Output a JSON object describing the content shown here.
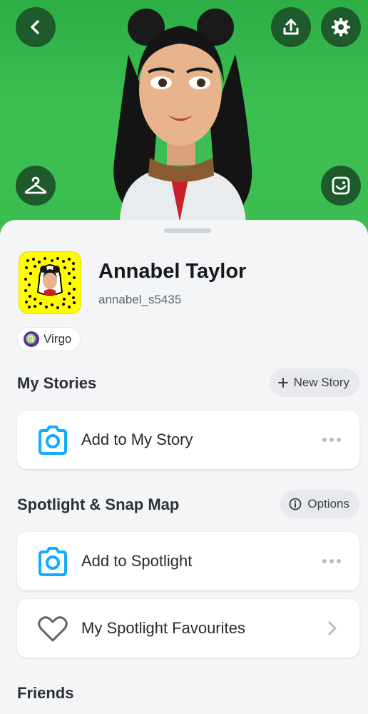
{
  "header": {
    "back_icon": "chevron-left-icon",
    "share_icon": "upload-icon",
    "settings_icon": "gear-icon",
    "outfit_icon": "hanger-icon",
    "selfie_icon": "bitmoji-selfie-icon",
    "background_color": "#3bbd50"
  },
  "profile": {
    "display_name": "Annabel Taylor",
    "username": "annabel_s5435",
    "zodiac": {
      "symbol": "♍",
      "label": "Virgo"
    }
  },
  "my_stories": {
    "title": "My Stories",
    "new_story_label": "New Story",
    "add_story_label": "Add to My Story"
  },
  "spotlight": {
    "title": "Spotlight & Snap Map",
    "options_label": "Options",
    "add_spotlight_label": "Add to Spotlight",
    "favourites_label": "My Spotlight Favourites"
  },
  "friends": {
    "title": "Friends"
  },
  "colors": {
    "accent_blue": "#0eadff",
    "snapcode_yellow": "#fffc00"
  }
}
